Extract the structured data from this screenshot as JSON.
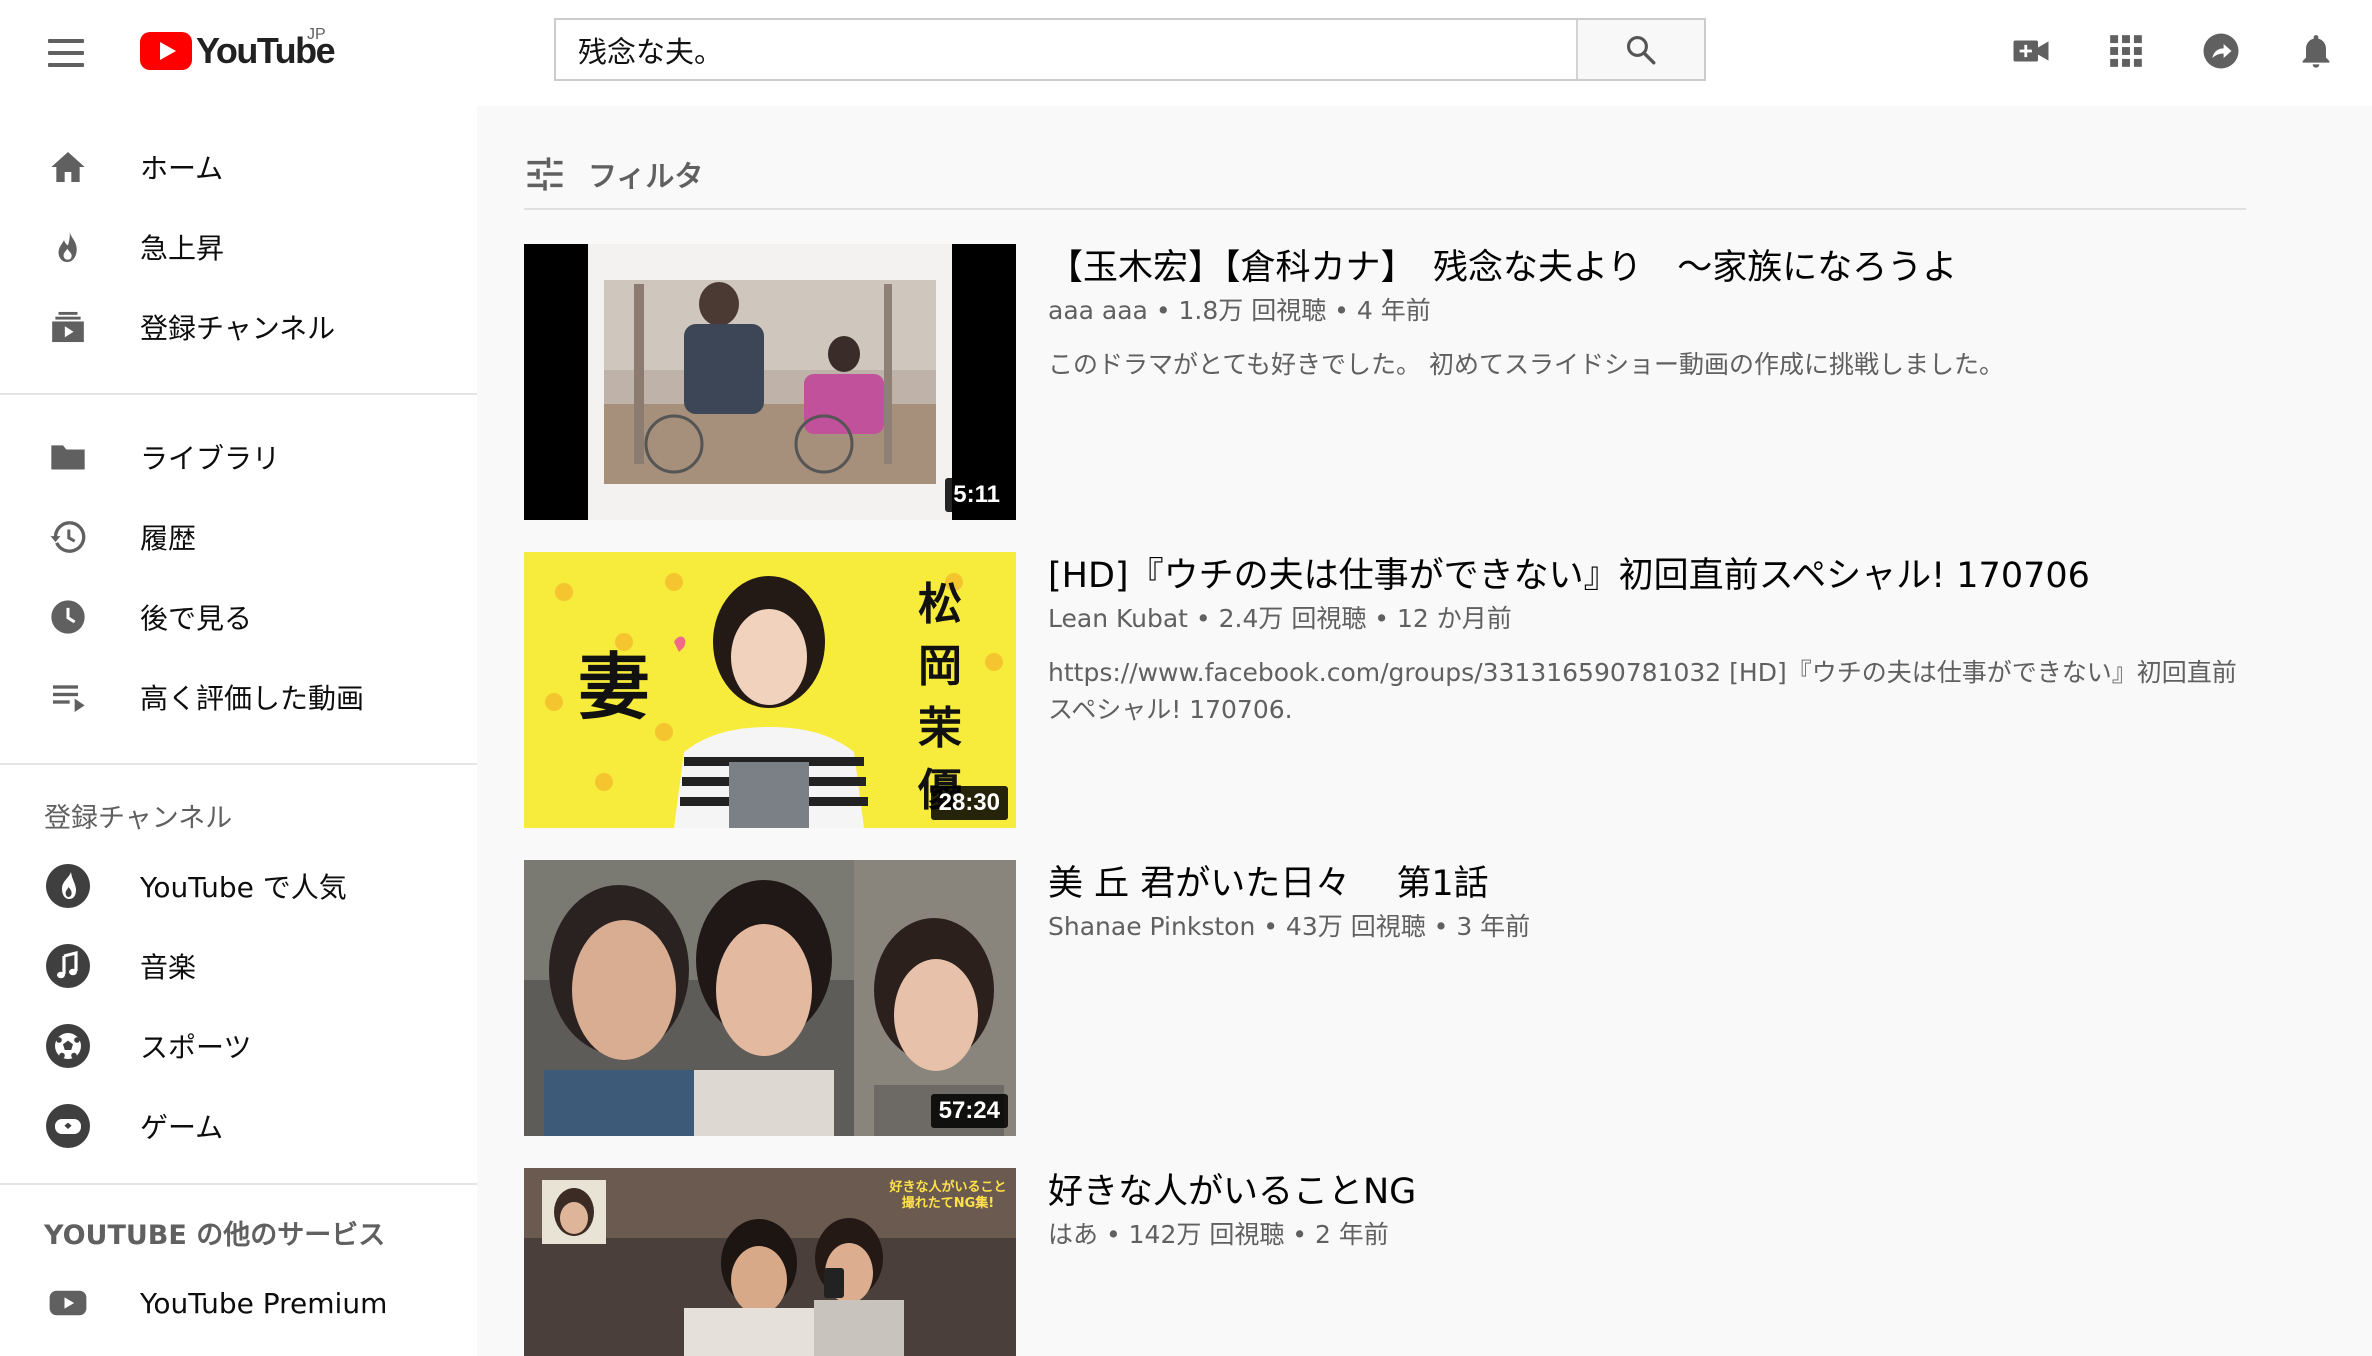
{
  "header": {
    "logo_text": "YouTube",
    "logo_region": "JP",
    "search_value": "残念な夫。",
    "icons": [
      "menu-icon",
      "search-icon",
      "video-camera-add-icon",
      "apps-grid-icon",
      "share-arrow-icon",
      "bell-icon"
    ]
  },
  "sidebar": {
    "main": [
      {
        "label": "ホーム",
        "icon": "home-icon"
      },
      {
        "label": "急上昇",
        "icon": "flame-icon"
      },
      {
        "label": "登録チャンネル",
        "icon": "subscriptions-icon"
      }
    ],
    "library": [
      {
        "label": "ライブラリ",
        "icon": "folder-icon"
      },
      {
        "label": "履歴",
        "icon": "history-icon"
      },
      {
        "label": "後で見る",
        "icon": "clock-icon"
      },
      {
        "label": "高く評価した動画",
        "icon": "playlist-icon"
      }
    ],
    "subs_heading": "登録チャンネル",
    "subs": [
      {
        "label": "YouTube で人気",
        "icon": "popular-icon"
      },
      {
        "label": "音楽",
        "icon": "music-icon"
      },
      {
        "label": "スポーツ",
        "icon": "sports-icon"
      },
      {
        "label": "ゲーム",
        "icon": "gaming-icon"
      }
    ],
    "more_heading": "YOUTUBE の他のサービス",
    "more": [
      {
        "label": "YouTube Premium",
        "icon": "youtube-premium-icon"
      }
    ]
  },
  "filter": {
    "label": "フィルタ"
  },
  "results": [
    {
      "title": "【玉木宏】【倉科カナ】　残念な夫より　〜家族になろうよ",
      "channel": "aaa aaa",
      "stats": " • 1.8万 回視聴 • 4 年前",
      "description": "このドラマがとても好きでした。 初めてスライドショー動画の作成に挑戦しました。",
      "duration": "5:11"
    },
    {
      "title": "[HD]『ウチの夫は仕事ができない』初回直前スペシャル! 170706",
      "channel": "Lean Kubat",
      "stats": " • 2.4万 回視聴 • 12 か月前",
      "description": "https://www.facebook.com/groups/331316590781032 [HD]『ウチの夫は仕事ができない』初回直前スペシャル! 170706.",
      "duration": "28:30",
      "thumb_text_big": "妻",
      "thumb_text_vertical": "松岡茉優"
    },
    {
      "title": "美 丘 君がいた日々　 第1話",
      "channel": "Shanae Pinkston",
      "stats": " • 43万 回視聴 • 3 年前",
      "description": "",
      "duration": "57:24"
    },
    {
      "title": "好きな人がいることNG",
      "channel": "はあ",
      "stats": " • 142万 回視聴 • 2 年前",
      "description": "",
      "duration": "",
      "thumb_caption": "好きな人がいること 撮れたてNG集!"
    }
  ]
}
